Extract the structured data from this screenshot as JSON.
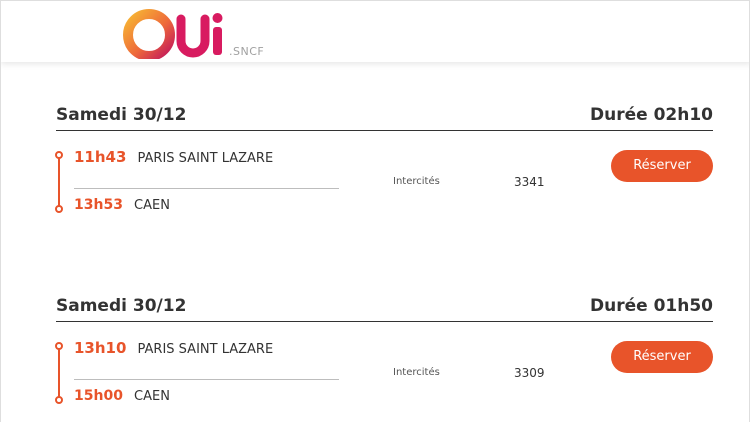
{
  "brand": {
    "logo_text": "OUi",
    "logo_suffix": ".SNCF",
    "colors": {
      "accent": "#e8542a",
      "logo_orange": "#f39c12",
      "logo_magenta": "#c2185b"
    }
  },
  "journeys": [
    {
      "date": "Samedi 30/12",
      "duration": "Durée 02h10",
      "departure": {
        "time": "11h43",
        "station": "PARIS SAINT LAZARE"
      },
      "arrival": {
        "time": "13h53",
        "station": "CAEN"
      },
      "train_type": "Intercités",
      "train_number": "3341",
      "book_label": "Réserver"
    },
    {
      "date": "Samedi 30/12",
      "duration": "Durée 01h50",
      "departure": {
        "time": "13h10",
        "station": "PARIS SAINT LAZARE"
      },
      "arrival": {
        "time": "15h00",
        "station": "CAEN"
      },
      "train_type": "Intercités",
      "train_number": "3309",
      "book_label": "Réserver"
    }
  ]
}
